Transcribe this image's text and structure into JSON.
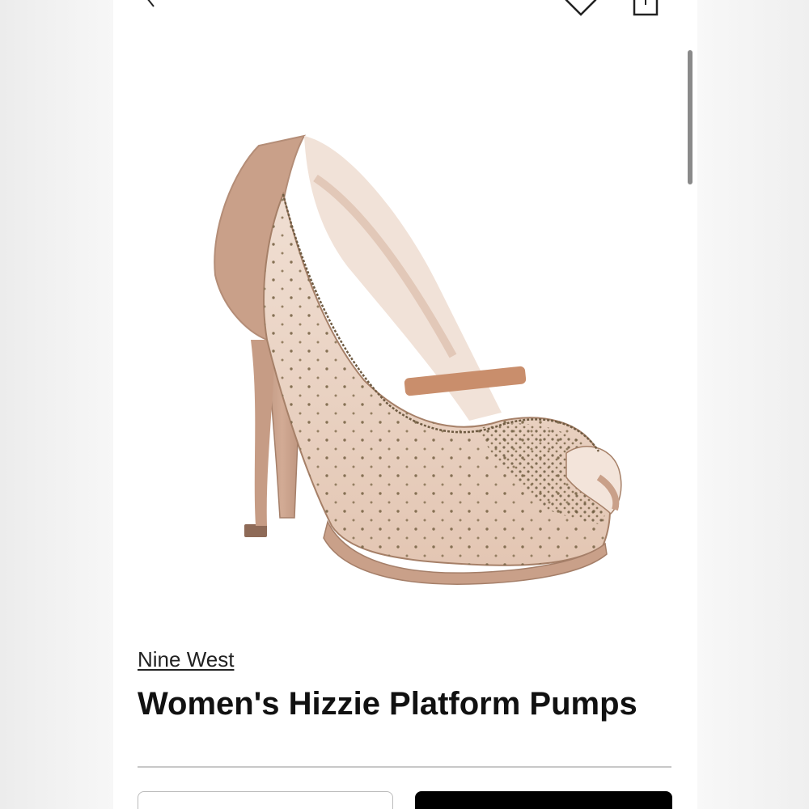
{
  "header": {
    "back_icon": "chevron-left-icon",
    "favorite_icon": "heart-icon",
    "share_icon": "share-icon"
  },
  "product": {
    "brand": "Nine West",
    "title": "Women's Hizzie Platform Pumps",
    "image_alt": "Blush mesh peep-toe platform pump with rhinestone embellishments"
  },
  "colors": {
    "shoe_suede": "#c9a089",
    "shoe_mesh": "#e9d2c2",
    "rhinestone": "#7a6648",
    "primary_button": "#000000"
  }
}
